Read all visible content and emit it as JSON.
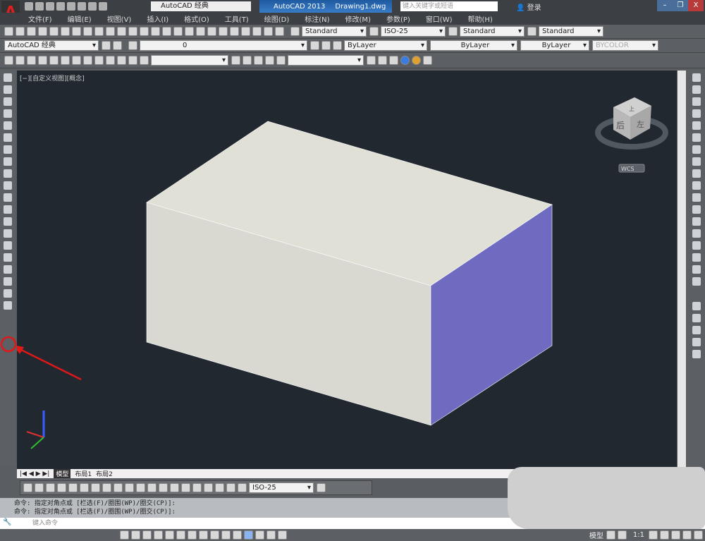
{
  "titlebar": {
    "workspace": "AutoCAD 经典",
    "app": "AutoCAD 2013",
    "file": "Drawing1.dwg",
    "search_placeholder": "键入关键字或短语",
    "login": "登录",
    "minimize": "–",
    "restore": "❐",
    "close": "X"
  },
  "menu": [
    "文件(F)",
    "编辑(E)",
    "视图(V)",
    "插入(I)",
    "格式(O)",
    "工具(T)",
    "绘图(D)",
    "标注(N)",
    "修改(M)",
    "参数(P)",
    "窗口(W)",
    "帮助(H)"
  ],
  "styles": {
    "text_style": "Standard",
    "dim_style": "ISO-25",
    "table_style": "Standard",
    "multileader_style": "Standard"
  },
  "layers": {
    "workspace": "AutoCAD 经典",
    "current_layer": "0",
    "color": "ByLayer",
    "linetype": "ByLayer",
    "lineweight": "ByLayer",
    "plotstyle": "BYCOLOR"
  },
  "viewport": {
    "label": "[−][自定义视图][概念]",
    "viewcube_face": "后",
    "viewcube_side": "左",
    "viewcube_top": "上",
    "ucs": "WCS",
    "colors": {
      "top": "#e0e0d6",
      "front": "#d9d9d2",
      "right": "#6e6bc0",
      "background": "#212830"
    }
  },
  "tabs": [
    "模型",
    "布局1",
    "布局2"
  ],
  "dim_toolbar": {
    "dim_style": "ISO-25"
  },
  "command": {
    "history": [
      "命令: 指定对角点或 [栏选(F)/圈围(WP)/圈交(CP)]:",
      "命令: 指定对角点或 [栏选(F)/圈围(WP)/圈交(CP)]:"
    ],
    "placeholder": "键入命令"
  },
  "status": {
    "model": "模型",
    "scale": "1:1"
  }
}
